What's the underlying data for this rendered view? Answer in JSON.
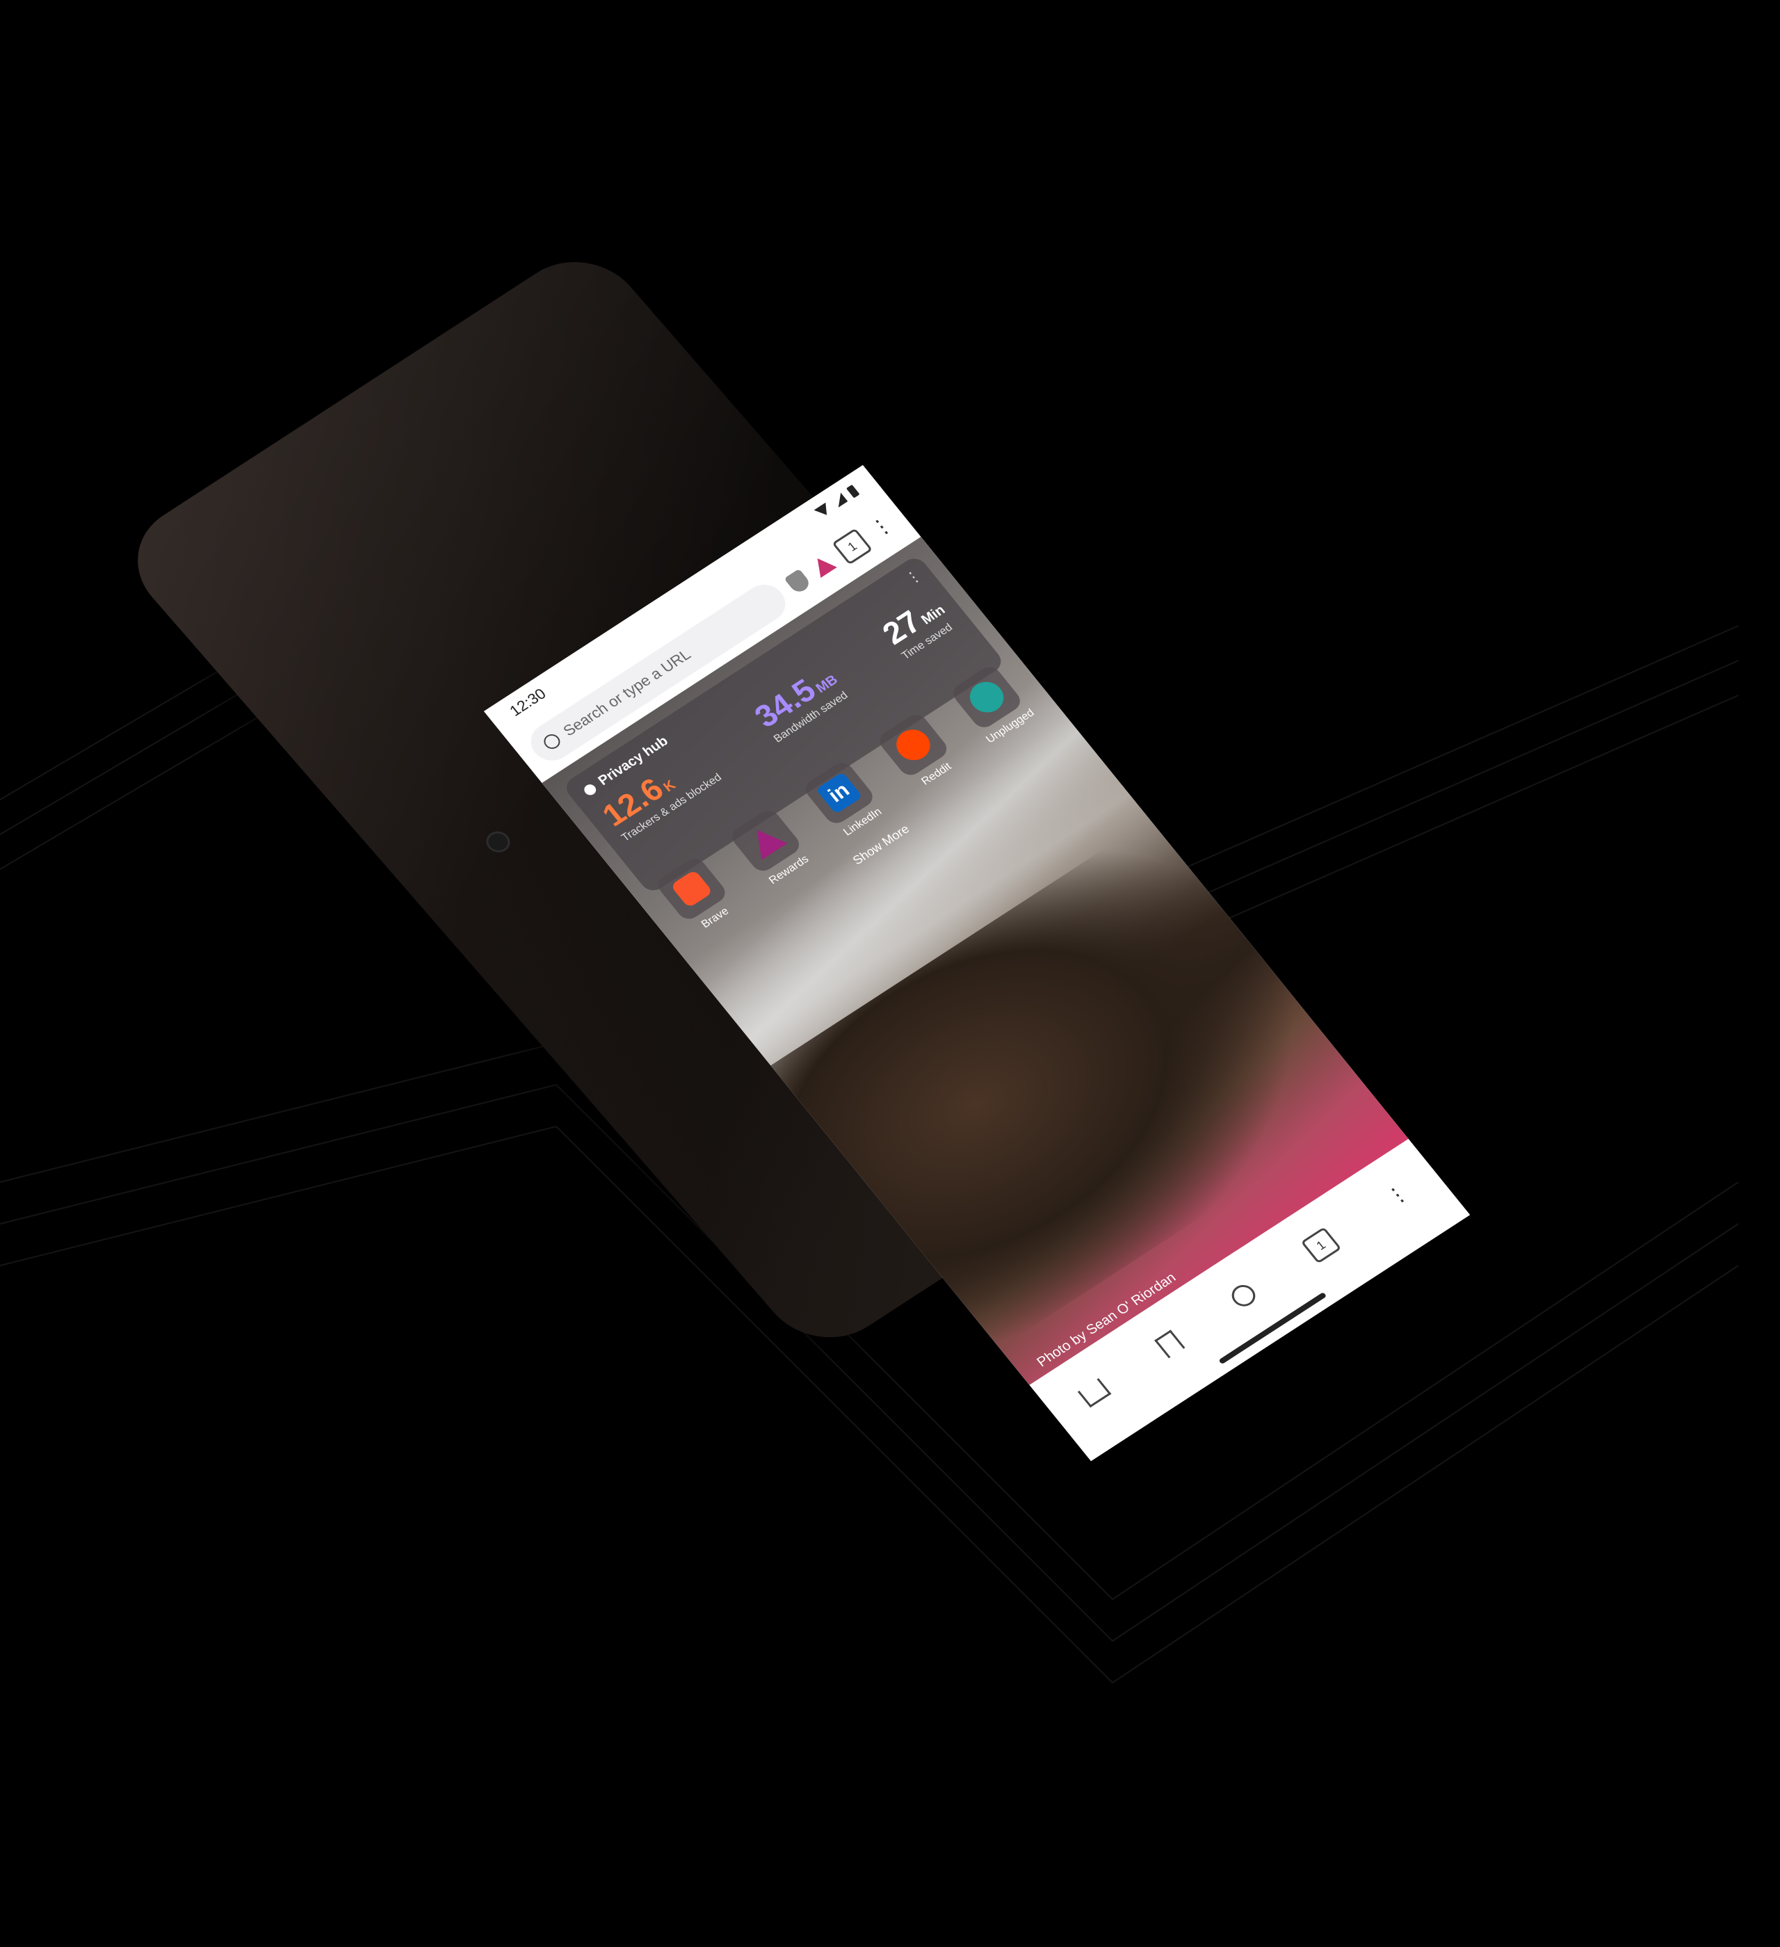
{
  "status_bar": {
    "time": "12:30"
  },
  "url_bar": {
    "placeholder": "Search or type a URL",
    "tab_count": "1"
  },
  "privacy_hub": {
    "title": "Privacy hub",
    "stats": [
      {
        "value": "12.6",
        "unit": "K",
        "label": "Trackers & ads blocked",
        "color": "#ff7a3d"
      },
      {
        "value": "34.5",
        "unit": "MB",
        "label": "Bandwidth saved",
        "color": "#a88cff"
      },
      {
        "value": "27",
        "unit": "Min",
        "label": "Time saved",
        "color": "#ffffff"
      }
    ]
  },
  "tiles": [
    {
      "label": "Brave",
      "icon": "brave-lion-icon"
    },
    {
      "label": "Rewards",
      "icon": "rewards-triangle-icon"
    },
    {
      "label": "LinkedIn",
      "icon": "linkedin-icon"
    },
    {
      "label": "Reddit",
      "icon": "reddit-icon"
    },
    {
      "label": "Unplugged",
      "icon": "unplugged-icon"
    }
  ],
  "show_more": "Show More",
  "photo_credit": "Photo by Sean O' Riordan",
  "toolbar": {
    "tab_count": "1",
    "icons": [
      "home-icon",
      "bookmark-icon",
      "search-icon",
      "tabs-icon",
      "menu-icon"
    ]
  }
}
